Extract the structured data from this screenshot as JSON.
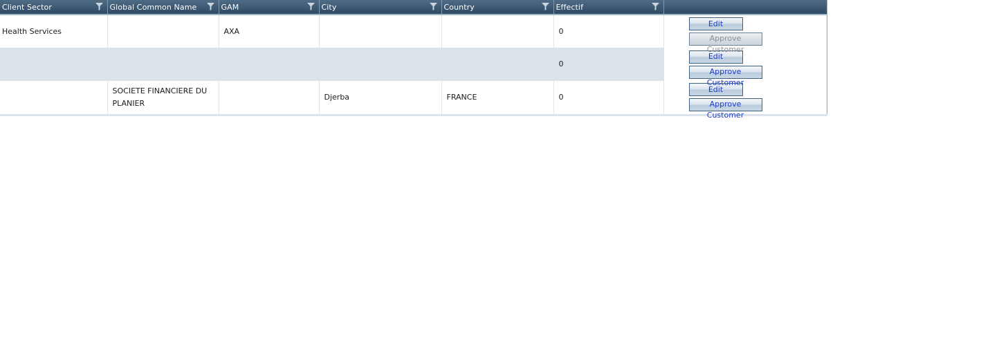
{
  "grid": {
    "columns": [
      {
        "label": "Client Sector",
        "filter_icon": "filter-icon"
      },
      {
        "label": "Global Common Name",
        "filter_icon": "filter-icon"
      },
      {
        "label": "GAM",
        "filter_icon": "filter-icon"
      },
      {
        "label": "City",
        "filter_icon": "filter-icon"
      },
      {
        "label": "Country",
        "filter_icon": "filter-icon"
      },
      {
        "label": "Effectif",
        "filter_icon": "filter-icon"
      },
      {
        "label": ""
      }
    ],
    "rows": [
      {
        "client_sector": "Health Services",
        "global_common_name": "",
        "gam": "AXA",
        "city": "",
        "country": "",
        "effectif": "0",
        "edit_label": "Edit",
        "approve_label": "Approve Customer",
        "approve_enabled": false
      },
      {
        "client_sector": "",
        "global_common_name": "",
        "gam": "",
        "city": "",
        "country": "",
        "effectif": "0",
        "edit_label": "Edit",
        "approve_label": "Approve Customer",
        "approve_enabled": true
      },
      {
        "client_sector": "",
        "global_common_name": "SOCIETE FINANCIERE DU PLANIER",
        "gam": "",
        "city": "Djerba",
        "country": "FRANCE",
        "effectif": "0",
        "edit_label": "Edit",
        "approve_label": "Approve Customer",
        "approve_enabled": true
      }
    ],
    "colors": {
      "header_bg": "#3f5b76",
      "alt_row_bg": "#dbe2e9",
      "button_text": "#1a39c9",
      "disabled_text": "#8a8f95"
    }
  }
}
